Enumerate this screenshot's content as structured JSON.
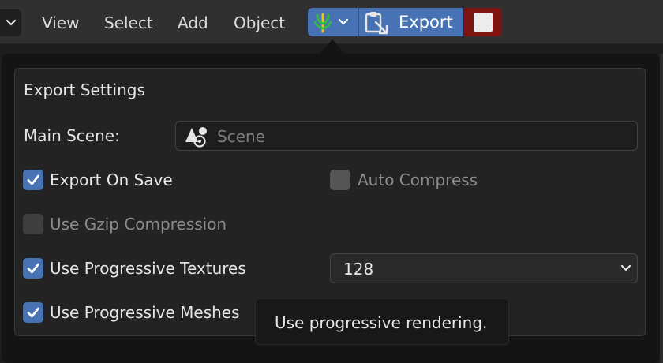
{
  "header": {
    "menu": [
      {
        "label": "View"
      },
      {
        "label": "Select"
      },
      {
        "label": "Add"
      },
      {
        "label": "Object"
      }
    ],
    "addon_icon": "plant-sprout-icon",
    "export_label": "Export",
    "export_icon": "export-clipboard-icon",
    "stop_icon": "stop-square-icon"
  },
  "panel": {
    "title": "Export Settings",
    "main_scene_label": "Main Scene:",
    "main_scene_value": "Scene",
    "export_on_save": {
      "label": "Export On Save",
      "checked": true
    },
    "auto_compress": {
      "label": "Auto Compress",
      "checked": false
    },
    "use_gzip": {
      "label": "Use Gzip Compression",
      "checked": false
    },
    "progressive_textures": {
      "label": "Use Progressive Textures",
      "checked": true,
      "size": "128"
    },
    "progressive_meshes": {
      "label": "Use Progressive Meshes",
      "checked": true
    }
  },
  "tooltip": {
    "text": "Use progressive rendering."
  },
  "colors": {
    "accent": "#4772b3",
    "stop": "#7d1414",
    "header": "#303030",
    "panel": "#232323"
  }
}
